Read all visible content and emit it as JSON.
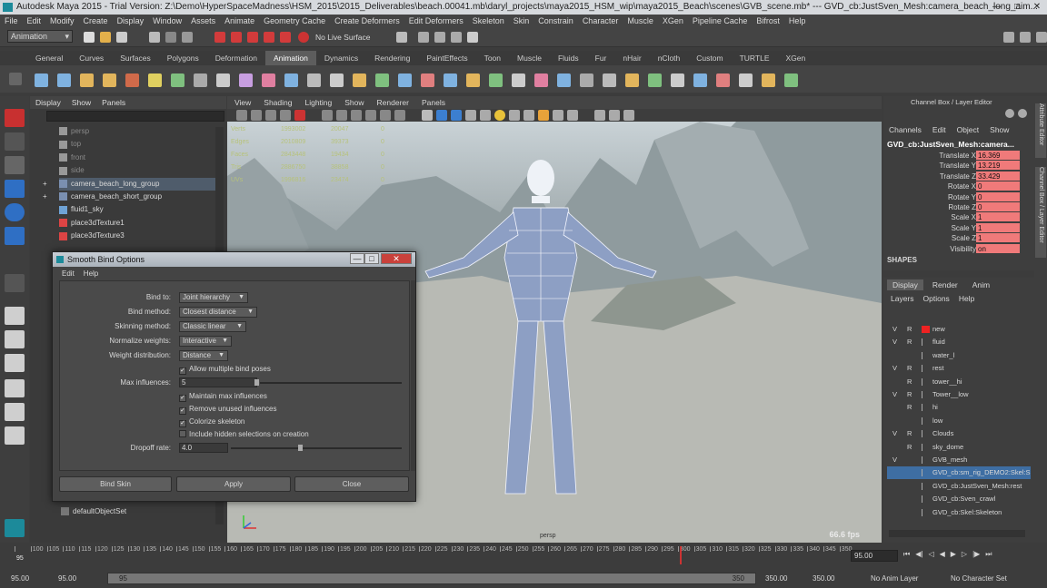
{
  "window": {
    "title": "Autodesk Maya 2015 - Trial Version: Z:\\Demo\\HyperSpaceMadness\\HSM_2015\\2015_Deliverables\\beach.00041.mb\\daryl_projects\\maya2015_HSM_wip\\maya2015_Beach\\scenes\\GVB_scene.mb* --- GVD_cb:JustSven_Mesh:camera_beach_long_aim..."
  },
  "menubar": [
    "File",
    "Edit",
    "Modify",
    "Create",
    "Display",
    "Window",
    "Assets",
    "Animate",
    "Geometry Cache",
    "Create Deformers",
    "Edit Deformers",
    "Skeleton",
    "Skin",
    "Constrain",
    "Character",
    "Muscle",
    "XGen",
    "Pipeline Cache",
    "Bifrost",
    "Help"
  ],
  "statusline": {
    "mode": "Animation",
    "live_surface": "No Live Surface"
  },
  "shelf_tabs": [
    "General",
    "Curves",
    "Surfaces",
    "Polygons",
    "Deformation",
    "Animation",
    "Dynamics",
    "Rendering",
    "PaintEffects",
    "Toon",
    "Muscle",
    "Fluids",
    "Fur",
    "nHair",
    "nCloth",
    "Custom",
    "TURTLE",
    "XGen"
  ],
  "shelf_active": "Animation",
  "outliner": {
    "menu": [
      "Display",
      "Show",
      "Panels"
    ],
    "items": [
      "persp",
      "top",
      "front",
      "side",
      "camera_beach_long_group",
      "camera_beach_short_group",
      "fluid1_sky",
      "place3dTexture1",
      "place3dTexture3"
    ],
    "bottom_item": "defaultObjectSet"
  },
  "viewport": {
    "menu": [
      "View",
      "Shading",
      "Lighting",
      "Show",
      "Renderer",
      "Panels"
    ],
    "hud": [
      {
        "label": "Verts",
        "v1": "1993002",
        "v2": "20047",
        "v3": "0"
      },
      {
        "label": "Edges",
        "v1": "2010809",
        "v2": "39373",
        "v3": "0"
      },
      {
        "label": "Faces",
        "v1": "2843448",
        "v2": "19434",
        "v3": "0"
      },
      {
        "label": "Tris",
        "v1": "2886750",
        "v2": "38858",
        "v3": "0"
      },
      {
        "label": "UVs",
        "v1": "1996816",
        "v2": "23474",
        "v3": "0"
      }
    ],
    "fps": "66.6 fps",
    "camera": "persp"
  },
  "dialog": {
    "title": "Smooth Bind Options",
    "menu": [
      "Edit",
      "Help"
    ],
    "fields": {
      "bind_to": {
        "label": "Bind to:",
        "value": "Joint hierarchy"
      },
      "bind_method": {
        "label": "Bind method:",
        "value": "Closest distance"
      },
      "skinning_method": {
        "label": "Skinning method:",
        "value": "Classic linear"
      },
      "normalize_weights": {
        "label": "Normalize weights:",
        "value": "Interactive"
      },
      "weight_distribution": {
        "label": "Weight distribution:",
        "value": "Distance"
      },
      "allow_multiple": {
        "label": "Allow multiple bind poses",
        "checked": true
      },
      "max_influences": {
        "label": "Max influences:",
        "value": "5"
      },
      "maintain_max": {
        "label": "Maintain max influences",
        "checked": true
      },
      "remove_unused": {
        "label": "Remove unused influences",
        "checked": true
      },
      "colorize": {
        "label": "Colorize skeleton",
        "checked": true
      },
      "include_hidden": {
        "label": "Include hidden selections on creation",
        "checked": false
      },
      "dropoff_rate": {
        "label": "Dropoff rate:",
        "value": "4.0"
      }
    },
    "buttons": {
      "bind": "Bind Skin",
      "apply": "Apply",
      "close": "Close"
    }
  },
  "channelbox": {
    "title": "Channel Box / Layer Editor",
    "menu": [
      "Channels",
      "Edit",
      "Object",
      "Show"
    ],
    "object": "GVD_cb:JustSven_Mesh:camera...",
    "attrs": [
      {
        "label": "Translate X",
        "value": "16.369"
      },
      {
        "label": "Translate Y",
        "value": "13.219"
      },
      {
        "label": "Translate Z",
        "value": "33.429"
      },
      {
        "label": "Rotate X",
        "value": "0"
      },
      {
        "label": "Rotate Y",
        "value": "0"
      },
      {
        "label": "Rotate Z",
        "value": "0"
      },
      {
        "label": "Scale X",
        "value": "1"
      },
      {
        "label": "Scale Y",
        "value": "1"
      },
      {
        "label": "Scale Z",
        "value": "1"
      },
      {
        "label": "Visibility",
        "value": "on"
      }
    ],
    "shapes": "SHAPES"
  },
  "layers": {
    "tabs": [
      "Display",
      "Render",
      "Anim"
    ],
    "menu": [
      "Layers",
      "Options",
      "Help"
    ],
    "items": [
      {
        "v": "V",
        "r": "R",
        "name": "new"
      },
      {
        "v": "V",
        "r": "R",
        "name": "fluid"
      },
      {
        "v": "",
        "r": "",
        "name": "water_l"
      },
      {
        "v": "V",
        "r": "R",
        "name": "rest"
      },
      {
        "v": "",
        "r": "R",
        "name": "tower__hi"
      },
      {
        "v": "V",
        "r": "R",
        "name": "Tower__low"
      },
      {
        "v": "",
        "r": "R",
        "name": "hi"
      },
      {
        "v": "",
        "r": "",
        "name": "low"
      },
      {
        "v": "V",
        "r": "R",
        "name": "Clouds"
      },
      {
        "v": "",
        "r": "R",
        "name": "sky_dome"
      },
      {
        "v": "V",
        "r": "",
        "name": "GVB_mesh"
      },
      {
        "v": "",
        "r": "",
        "name": "GVD_cb:sm_rig_DEMO2:Skel:S"
      },
      {
        "v": "",
        "r": "",
        "name": "GVD_cb:JustSven_Mesh:rest"
      },
      {
        "v": "",
        "r": "",
        "name": "GVD_cb:Sven_crawl"
      },
      {
        "v": "",
        "r": "",
        "name": "GVD_cb:Skel:Skeleton"
      }
    ]
  },
  "side_tabs": [
    "Attribute Editor",
    "Channel Box / Layer Editor"
  ],
  "timeline": {
    "ticks": [
      "95",
      "100",
      "105",
      "110",
      "115",
      "120",
      "125",
      "130",
      "135",
      "140",
      "145",
      "150",
      "155",
      "160",
      "165",
      "170",
      "175",
      "180",
      "185",
      "190",
      "195",
      "200",
      "205",
      "210",
      "215",
      "220",
      "225",
      "230",
      "235",
      "240",
      "245",
      "250",
      "255",
      "260",
      "265",
      "270",
      "275",
      "280",
      "285",
      "290",
      "295",
      "300",
      "305",
      "310",
      "315",
      "320",
      "325",
      "330",
      "335",
      "340",
      "345",
      "350"
    ],
    "current_frame": "95.00",
    "range_start": "95.00",
    "start": "95.00",
    "range_label": "95",
    "range_end_label": "350",
    "end": "350.00",
    "end2": "350.00",
    "anim_layer": "No Anim Layer",
    "char_set": "No Character Set"
  }
}
